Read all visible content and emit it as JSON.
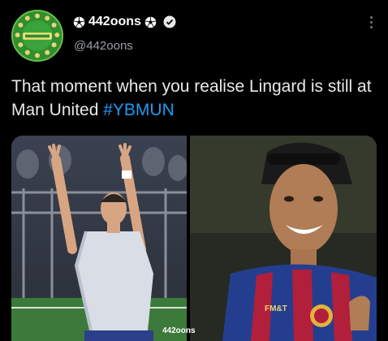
{
  "account": {
    "display_name": "442oons",
    "handle": "@442oons",
    "verified": true,
    "avatar_icon": "442oons-logo-icon",
    "name_decoration_icon": "soccer-ball-icon"
  },
  "tweet": {
    "text_before": "That moment when you realise Lingard is still at Man United ",
    "hashtag": "#YBMUN"
  },
  "media": {
    "left_photo": "footballer-arms-raised-photo",
    "right_photo": "footballer-smiling-barcelona-kit-photo",
    "right_photo_sponsor": "FM&T",
    "watermark": "442oons"
  },
  "colors": {
    "background": "#000000",
    "text": "#e7e9ea",
    "secondary": "#9aa0a6",
    "link": "#1d9bf0",
    "avatar_green": "#2d8a2f"
  }
}
